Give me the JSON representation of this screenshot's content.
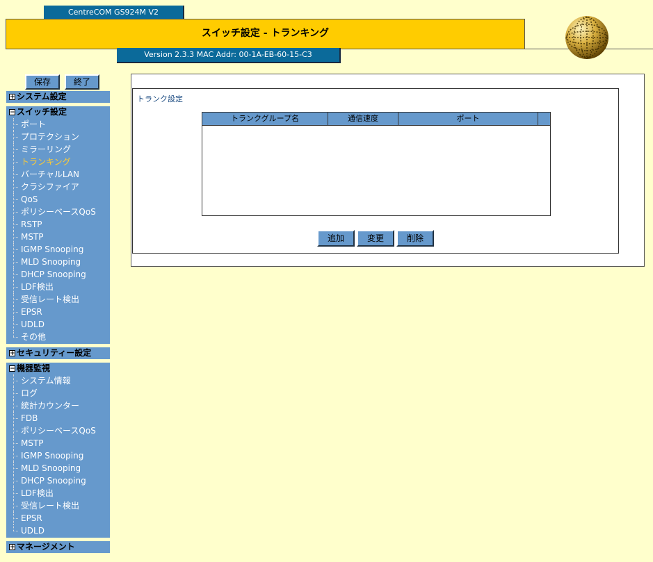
{
  "header": {
    "model": "CentreCOM GS924M V2",
    "title": "スイッチ設定 - トランキング",
    "version": "Version 2.3.3 MAC Addr: 00-1A-EB-60-15-C3"
  },
  "top_buttons": {
    "save": "保存",
    "exit": "終了"
  },
  "sidebar": {
    "system": {
      "label": "システム設定",
      "expand": "+"
    },
    "switch": {
      "label": "スイッチ設定",
      "expand": "−",
      "items": [
        "ポート",
        "プロテクション",
        "ミラーリング",
        "トランキング",
        "バーチャルLAN",
        "クラシファイア",
        "QoS",
        "ポリシーベースQoS",
        "RSTP",
        "MSTP",
        "IGMP Snooping",
        "MLD Snooping",
        "DHCP Snooping",
        "LDF検出",
        "受信レート検出",
        "EPSR",
        "UDLD",
        "その他"
      ],
      "active": "トランキング"
    },
    "security": {
      "label": "セキュリティー設定",
      "expand": "+"
    },
    "monitor": {
      "label": "機器監視",
      "expand": "−",
      "items": [
        "システム情報",
        "ログ",
        "統計カウンター",
        "FDB",
        "ポリシーベースQoS",
        "MSTP",
        "IGMP Snooping",
        "MLD Snooping",
        "DHCP Snooping",
        "LDF検出",
        "受信レート検出",
        "EPSR",
        "UDLD"
      ]
    },
    "management": {
      "label": "マネージメント",
      "expand": "+"
    }
  },
  "main": {
    "section_title": "トランク設定",
    "table": {
      "headers": [
        "トランクグループ名",
        "通信速度",
        "ポート"
      ]
    },
    "buttons": {
      "add": "追加",
      "edit": "変更",
      "delete": "削除"
    }
  }
}
